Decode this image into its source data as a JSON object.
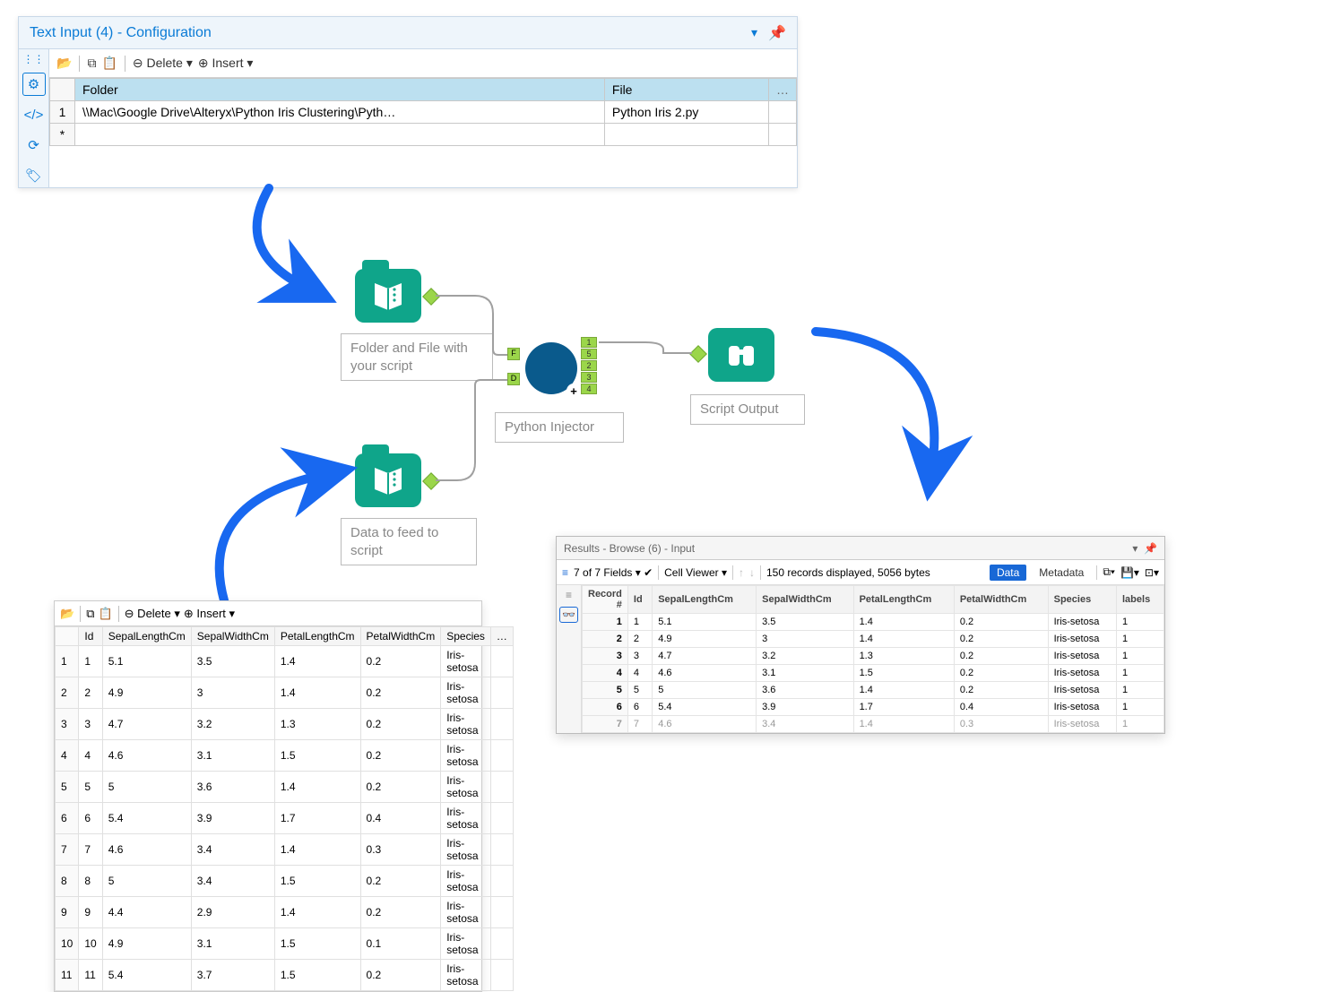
{
  "config": {
    "title": "Text Input (4) - Configuration",
    "toolbar": {
      "delete": "⊖ Delete ▾",
      "insert": "⊕ Insert ▾"
    },
    "cols": [
      "Folder",
      "File"
    ],
    "row1": {
      "num": "1",
      "folder": "\\\\Mac\\Google Drive\\Alteryx\\Python Iris Clustering\\Pyth…",
      "file": "Python Iris 2.py"
    },
    "row2_num": "*"
  },
  "workflow": {
    "node1_label": "Folder and File with your script",
    "node2_label": "Data to feed to script",
    "macro_label": "Python Injector",
    "output_label": "Script Output",
    "ports": [
      "1",
      "5",
      "2",
      "3",
      "4"
    ],
    "port_f": "F",
    "port_d": "D"
  },
  "small": {
    "toolbar": {
      "delete": "⊖ Delete ▾",
      "insert": "⊕ Insert ▾"
    },
    "cols": [
      "",
      "Id",
      "SepalLengthCm",
      "SepalWidthCm",
      "PetalLengthCm",
      "PetalWidthCm",
      "Species",
      "…"
    ],
    "rows": [
      [
        "1",
        "1",
        "5.1",
        "3.5",
        "1.4",
        "0.2",
        "Iris-setosa"
      ],
      [
        "2",
        "2",
        "4.9",
        "3",
        "1.4",
        "0.2",
        "Iris-setosa"
      ],
      [
        "3",
        "3",
        "4.7",
        "3.2",
        "1.3",
        "0.2",
        "Iris-setosa"
      ],
      [
        "4",
        "4",
        "4.6",
        "3.1",
        "1.5",
        "0.2",
        "Iris-setosa"
      ],
      [
        "5",
        "5",
        "5",
        "3.6",
        "1.4",
        "0.2",
        "Iris-setosa"
      ],
      [
        "6",
        "6",
        "5.4",
        "3.9",
        "1.7",
        "0.4",
        "Iris-setosa"
      ],
      [
        "7",
        "7",
        "4.6",
        "3.4",
        "1.4",
        "0.3",
        "Iris-setosa"
      ],
      [
        "8",
        "8",
        "5",
        "3.4",
        "1.5",
        "0.2",
        "Iris-setosa"
      ],
      [
        "9",
        "9",
        "4.4",
        "2.9",
        "1.4",
        "0.2",
        "Iris-setosa"
      ],
      [
        "10",
        "10",
        "4.9",
        "3.1",
        "1.5",
        "0.1",
        "Iris-setosa"
      ],
      [
        "11",
        "11",
        "5.4",
        "3.7",
        "1.5",
        "0.2",
        "Iris-setosa"
      ]
    ]
  },
  "results": {
    "title": "Results - Browse (6) - Input",
    "fields_text": "7 of 7 Fields  ▾ ✔",
    "cell_viewer": "Cell Viewer  ▾",
    "status": "150 records displayed, 5056 bytes",
    "tab_data": "Data",
    "tab_meta": "Metadata",
    "cols": [
      "Record #",
      "Id",
      "SepalLengthCm",
      "SepalWidthCm",
      "PetalLengthCm",
      "PetalWidthCm",
      "Species",
      "labels"
    ],
    "rows": [
      [
        "1",
        "1",
        "5.1",
        "3.5",
        "1.4",
        "0.2",
        "Iris-setosa",
        "1"
      ],
      [
        "2",
        "2",
        "4.9",
        "3",
        "1.4",
        "0.2",
        "Iris-setosa",
        "1"
      ],
      [
        "3",
        "3",
        "4.7",
        "3.2",
        "1.3",
        "0.2",
        "Iris-setosa",
        "1"
      ],
      [
        "4",
        "4",
        "4.6",
        "3.1",
        "1.5",
        "0.2",
        "Iris-setosa",
        "1"
      ],
      [
        "5",
        "5",
        "5",
        "3.6",
        "1.4",
        "0.2",
        "Iris-setosa",
        "1"
      ],
      [
        "6",
        "6",
        "5.4",
        "3.9",
        "1.7",
        "0.4",
        "Iris-setosa",
        "1"
      ],
      [
        "7",
        "7",
        "4.6",
        "3.4",
        "1.4",
        "0.3",
        "Iris-setosa",
        "1"
      ]
    ]
  },
  "chart_data": {
    "type": "table",
    "title": "Iris dataset (first 11 rows) fed to Python Injector",
    "columns": [
      "Id",
      "SepalLengthCm",
      "SepalWidthCm",
      "PetalLengthCm",
      "PetalWidthCm",
      "Species"
    ],
    "rows": [
      [
        1,
        5.1,
        3.5,
        1.4,
        0.2,
        "Iris-setosa"
      ],
      [
        2,
        4.9,
        3.0,
        1.4,
        0.2,
        "Iris-setosa"
      ],
      [
        3,
        4.7,
        3.2,
        1.3,
        0.2,
        "Iris-setosa"
      ],
      [
        4,
        4.6,
        3.1,
        1.5,
        0.2,
        "Iris-setosa"
      ],
      [
        5,
        5.0,
        3.6,
        1.4,
        0.2,
        "Iris-setosa"
      ],
      [
        6,
        5.4,
        3.9,
        1.7,
        0.4,
        "Iris-setosa"
      ],
      [
        7,
        4.6,
        3.4,
        1.4,
        0.3,
        "Iris-setosa"
      ],
      [
        8,
        5.0,
        3.4,
        1.5,
        0.2,
        "Iris-setosa"
      ],
      [
        9,
        4.4,
        2.9,
        1.4,
        0.2,
        "Iris-setosa"
      ],
      [
        10,
        4.9,
        3.1,
        1.5,
        0.1,
        "Iris-setosa"
      ],
      [
        11,
        5.4,
        3.7,
        1.5,
        0.2,
        "Iris-setosa"
      ]
    ]
  }
}
